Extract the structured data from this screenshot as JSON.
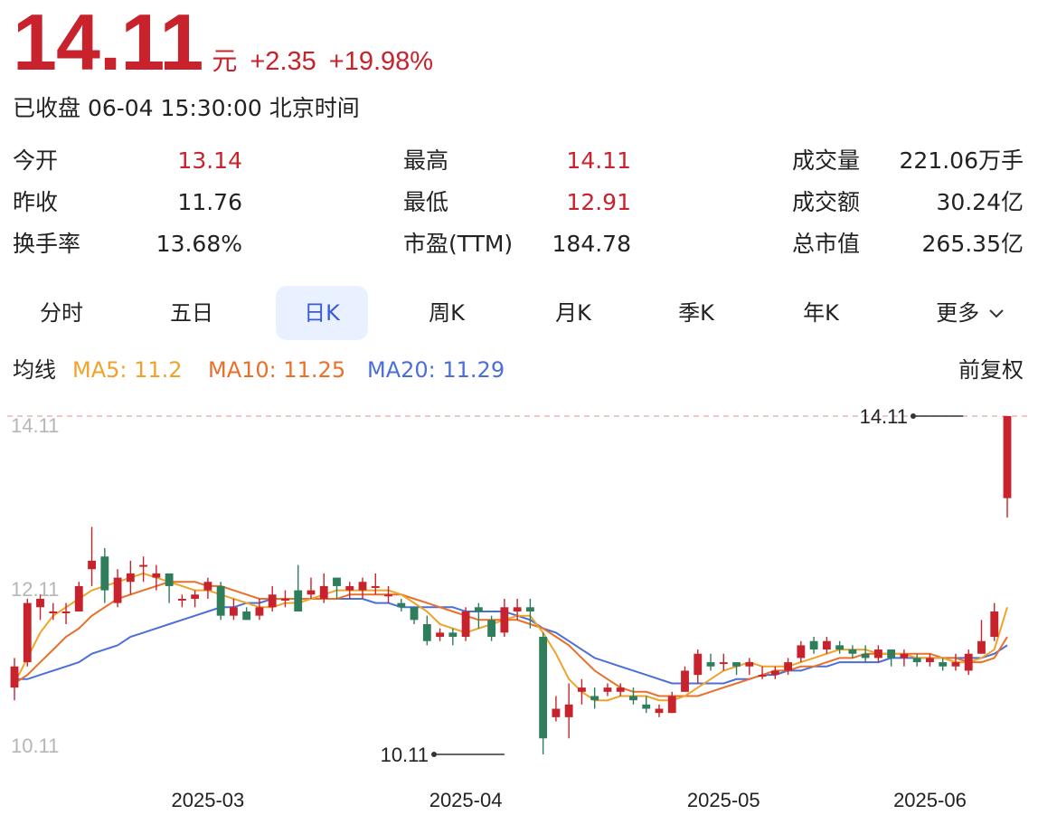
{
  "quote": {
    "price": "14.11",
    "unit": "元",
    "change": "+2.35",
    "change_pct": "+19.98%",
    "status": "已收盘 06-04 15:30:00 北京时间"
  },
  "stats": [
    {
      "label": "今开",
      "value": "13.14",
      "tone": "red"
    },
    {
      "label": "最高",
      "value": "14.11",
      "tone": "red"
    },
    {
      "label": "成交量",
      "value": "221.06万手",
      "tone": "dark"
    },
    {
      "label": "昨收",
      "value": "11.76",
      "tone": "dark"
    },
    {
      "label": "最低",
      "value": "12.91",
      "tone": "red"
    },
    {
      "label": "成交额",
      "value": "30.24亿",
      "tone": "dark"
    },
    {
      "label": "换手率",
      "value": "13.68%",
      "tone": "dark"
    },
    {
      "label": "市盈(TTM)",
      "value": "184.78",
      "tone": "dark"
    },
    {
      "label": "总市值",
      "value": "265.35亿",
      "tone": "dark"
    }
  ],
  "tabs": {
    "items": [
      "分时",
      "五日",
      "日K",
      "周K",
      "月K",
      "季K",
      "年K",
      "更多"
    ],
    "active": "日K"
  },
  "ma": {
    "title": "均线",
    "ma5": "MA5: 11.2",
    "ma10": "MA10: 11.25",
    "ma20": "MA20: 11.29",
    "adjust": "前复权"
  },
  "colors": {
    "up": "#c8232c",
    "down": "#2e7d5b",
    "ma5": "#f0a32a",
    "ma10": "#e8702a",
    "ma20": "#4b6fd8",
    "accent": "#3a5bd8"
  },
  "chart_data": {
    "type": "candlestick",
    "y_ticks": [
      "14.11",
      "12.11",
      "10.11"
    ],
    "ylim": [
      10.11,
      14.11
    ],
    "x_ticks": [
      {
        "label": "2025-03",
        "index": 15
      },
      {
        "label": "2025-04",
        "index": 35
      },
      {
        "label": "2025-05",
        "index": 55
      },
      {
        "label": "2025-06",
        "index": 71
      }
    ],
    "max_marker": {
      "label": "14.11",
      "index": 74
    },
    "min_marker": {
      "label": "10.11",
      "index": 38
    },
    "candles": [
      [
        10.9,
        11.15,
        11.25,
        10.75
      ],
      [
        11.2,
        11.9,
        11.95,
        11.15
      ],
      [
        11.85,
        11.95,
        12.0,
        11.7
      ],
      [
        11.8,
        11.8,
        11.9,
        11.7
      ],
      [
        11.8,
        11.8,
        11.9,
        11.65
      ],
      [
        11.8,
        12.1,
        12.15,
        11.8
      ],
      [
        12.3,
        12.4,
        12.8,
        12.1
      ],
      [
        12.45,
        12.05,
        12.55,
        11.9
      ],
      [
        11.9,
        12.2,
        12.3,
        11.85
      ],
      [
        12.15,
        12.25,
        12.4,
        12.0
      ],
      [
        12.35,
        12.35,
        12.45,
        12.15
      ],
      [
        12.2,
        12.25,
        12.35,
        12.05
      ],
      [
        12.25,
        12.1,
        12.2,
        11.9
      ],
      [
        11.95,
        11.95,
        12.0,
        11.85
      ],
      [
        11.95,
        12.0,
        12.05,
        11.85
      ],
      [
        12.05,
        12.15,
        12.2,
        11.95
      ],
      [
        12.1,
        11.75,
        12.15,
        11.7
      ],
      [
        11.75,
        11.85,
        11.95,
        11.7
      ],
      [
        11.8,
        11.7,
        11.85,
        11.7
      ],
      [
        11.75,
        11.85,
        11.95,
        11.7
      ],
      [
        11.85,
        12.0,
        12.1,
        11.8
      ],
      [
        11.95,
        11.95,
        12.05,
        11.85
      ],
      [
        12.05,
        11.8,
        12.35,
        11.8
      ],
      [
        12.0,
        12.05,
        12.2,
        11.95
      ],
      [
        11.95,
        12.1,
        12.25,
        11.9
      ],
      [
        12.2,
        12.1,
        12.2,
        11.95
      ],
      [
        12.05,
        12.1,
        12.15,
        11.95
      ],
      [
        12.05,
        12.15,
        12.2,
        11.95
      ],
      [
        12.1,
        12.1,
        12.25,
        12.0
      ],
      [
        12.0,
        12.0,
        12.1,
        11.9
      ],
      [
        11.9,
        11.85,
        11.95,
        11.8
      ],
      [
        11.85,
        11.7,
        11.85,
        11.65
      ],
      [
        11.65,
        11.45,
        11.75,
        11.4
      ],
      [
        11.5,
        11.55,
        11.6,
        11.45
      ],
      [
        11.55,
        11.5,
        11.6,
        11.4
      ],
      [
        11.5,
        11.8,
        11.85,
        11.45
      ],
      [
        11.85,
        11.8,
        11.9,
        11.6
      ],
      [
        11.7,
        11.5,
        11.75,
        11.45
      ],
      [
        11.55,
        11.85,
        11.95,
        11.5
      ],
      [
        11.8,
        11.85,
        11.95,
        11.7
      ],
      [
        11.85,
        11.8,
        11.95,
        11.6
      ],
      [
        11.5,
        10.3,
        11.55,
        10.11
      ],
      [
        10.55,
        10.65,
        10.8,
        10.5
      ],
      [
        10.55,
        10.7,
        10.95,
        10.3
      ],
      [
        10.85,
        10.9,
        11.0,
        10.7
      ],
      [
        10.8,
        10.75,
        10.9,
        10.65
      ],
      [
        10.85,
        10.9,
        10.95,
        10.8
      ],
      [
        10.85,
        10.9,
        10.95,
        10.8
      ],
      [
        10.8,
        10.75,
        10.9,
        10.7
      ],
      [
        10.7,
        10.65,
        10.8,
        10.6
      ],
      [
        10.6,
        10.65,
        10.7,
        10.55
      ],
      [
        10.6,
        10.8,
        10.85,
        10.6
      ],
      [
        10.85,
        11.1,
        11.15,
        10.85
      ],
      [
        11.05,
        11.3,
        11.35,
        10.95
      ],
      [
        11.2,
        11.15,
        11.3,
        11.1
      ],
      [
        11.2,
        11.2,
        11.3,
        11.1
      ],
      [
        11.2,
        11.15,
        11.2,
        11.05
      ],
      [
        11.15,
        11.2,
        11.25,
        11.05
      ],
      [
        11.05,
        11.05,
        11.15,
        11.0
      ],
      [
        11.05,
        11.1,
        11.15,
        11.0
      ],
      [
        11.1,
        11.2,
        11.25,
        11.05
      ],
      [
        11.25,
        11.4,
        11.45,
        11.2
      ],
      [
        11.45,
        11.35,
        11.5,
        11.3
      ],
      [
        11.35,
        11.45,
        11.5,
        11.3
      ],
      [
        11.4,
        11.35,
        11.45,
        11.3
      ],
      [
        11.35,
        11.3,
        11.4,
        11.25
      ],
      [
        11.3,
        11.25,
        11.4,
        11.2
      ],
      [
        11.25,
        11.35,
        11.4,
        11.2
      ],
      [
        11.35,
        11.25,
        11.35,
        11.15
      ],
      [
        11.25,
        11.3,
        11.35,
        11.15
      ],
      [
        11.25,
        11.2,
        11.3,
        11.15
      ],
      [
        11.2,
        11.25,
        11.3,
        11.15
      ],
      [
        11.2,
        11.15,
        11.25,
        11.1
      ],
      [
        11.15,
        11.2,
        11.3,
        11.1
      ],
      [
        11.1,
        11.3,
        11.35,
        11.05
      ],
      [
        11.3,
        11.45,
        11.7,
        11.3
      ],
      [
        11.5,
        11.8,
        11.9,
        11.45
      ],
      [
        13.14,
        14.11,
        14.11,
        12.91
      ]
    ],
    "ma5": [
      10.95,
      11.25,
      11.55,
      11.75,
      11.85,
      11.95,
      12.05,
      12.1,
      12.15,
      12.2,
      12.25,
      12.2,
      12.15,
      12.1,
      12.05,
      12.05,
      12.0,
      11.95,
      11.9,
      11.85,
      11.85,
      11.9,
      11.9,
      11.95,
      12.0,
      12.05,
      12.05,
      12.05,
      12.05,
      12.05,
      12.0,
      11.9,
      11.8,
      11.65,
      11.6,
      11.55,
      11.6,
      11.65,
      11.7,
      11.75,
      11.75,
      11.55,
      11.3,
      11.0,
      10.85,
      10.75,
      10.75,
      10.8,
      10.8,
      10.8,
      10.75,
      10.75,
      10.8,
      10.9,
      11.0,
      11.1,
      11.15,
      11.2,
      11.15,
      11.15,
      11.15,
      11.2,
      11.25,
      11.3,
      11.35,
      11.35,
      11.35,
      11.3,
      11.3,
      11.3,
      11.25,
      11.25,
      11.25,
      11.2,
      11.2,
      11.25,
      11.35,
      11.85
    ],
    "ma10": [
      10.95,
      11.05,
      11.2,
      11.35,
      11.5,
      11.6,
      11.75,
      11.85,
      11.95,
      12.0,
      12.05,
      12.1,
      12.15,
      12.15,
      12.15,
      12.1,
      12.1,
      12.05,
      12.0,
      11.95,
      11.95,
      11.95,
      11.95,
      11.95,
      11.95,
      11.95,
      12.0,
      12.0,
      12.0,
      12.0,
      12.0,
      11.95,
      11.9,
      11.85,
      11.8,
      11.75,
      11.7,
      11.7,
      11.7,
      11.7,
      11.65,
      11.6,
      11.5,
      11.4,
      11.25,
      11.1,
      11.0,
      10.9,
      10.85,
      10.85,
      10.8,
      10.8,
      10.8,
      10.8,
      10.85,
      10.9,
      10.95,
      11.0,
      11.05,
      11.1,
      11.1,
      11.15,
      11.15,
      11.2,
      11.25,
      11.25,
      11.3,
      11.3,
      11.3,
      11.3,
      11.3,
      11.3,
      11.25,
      11.25,
      11.2,
      11.2,
      11.25,
      11.5
    ],
    "ma20": [
      11.0,
      11.0,
      11.05,
      11.1,
      11.15,
      11.2,
      11.3,
      11.35,
      11.4,
      11.5,
      11.55,
      11.6,
      11.65,
      11.7,
      11.75,
      11.8,
      11.85,
      11.85,
      11.9,
      11.9,
      11.95,
      11.95,
      11.95,
      11.95,
      11.95,
      11.95,
      11.95,
      11.95,
      11.9,
      11.9,
      11.85,
      11.85,
      11.85,
      11.85,
      11.85,
      11.8,
      11.8,
      11.8,
      11.8,
      11.75,
      11.7,
      11.6,
      11.55,
      11.45,
      11.35,
      11.25,
      11.2,
      11.15,
      11.1,
      11.05,
      11.0,
      10.95,
      10.95,
      10.95,
      10.95,
      10.95,
      11.0,
      11.0,
      11.05,
      11.05,
      11.1,
      11.1,
      11.15,
      11.15,
      11.2,
      11.2,
      11.2,
      11.2,
      11.25,
      11.25,
      11.25,
      11.25,
      11.25,
      11.25,
      11.25,
      11.25,
      11.3,
      11.4
    ]
  }
}
